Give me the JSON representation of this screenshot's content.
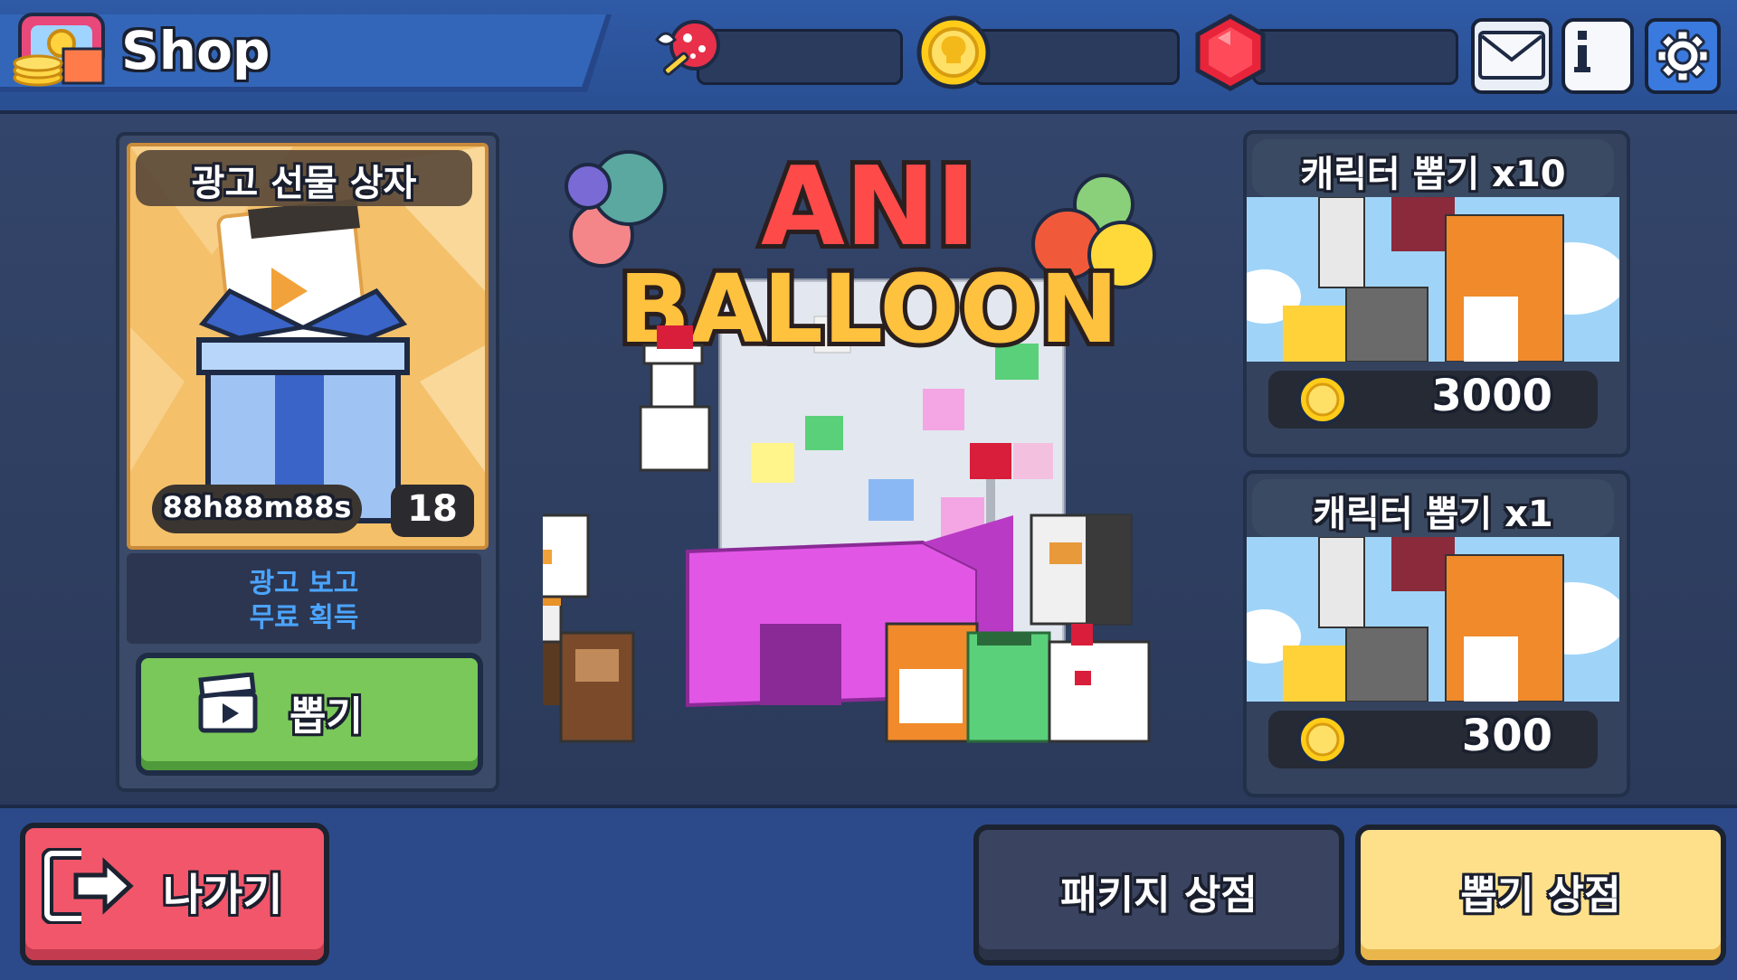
{
  "header": {
    "title": "Shop"
  },
  "resources": [
    {
      "icon": "heart-key-icon",
      "value": ""
    },
    {
      "icon": "gold-coin-icon",
      "value": ""
    },
    {
      "icon": "red-gem-icon",
      "value": ""
    }
  ],
  "top_buttons": {
    "mail": "mail-icon",
    "info": "info-icon",
    "settings": "gear-icon"
  },
  "ad_gift": {
    "title": "광고 선물 상자",
    "code": "88h88m88s",
    "count": "18",
    "desc_line1": "광고 보고",
    "desc_line2": "무료 획득",
    "button_label": "뽑기"
  },
  "logo": {
    "line1": "ANI",
    "line2": "BALLOON"
  },
  "draw_x10": {
    "title": "캐릭터 뽑기 x10",
    "price": "3000"
  },
  "draw_x1": {
    "title": "캐릭터 뽑기 x1",
    "price": "300"
  },
  "bottom": {
    "exit": "나가기",
    "package_shop": "패키지 상점",
    "gacha_shop": "뽑기 상점"
  },
  "colors": {
    "accent_blue": "#2f5aa6",
    "exit_red": "#f2566a",
    "draw_green": "#7ac85a",
    "gacha_yellow": "#ffe08a"
  }
}
